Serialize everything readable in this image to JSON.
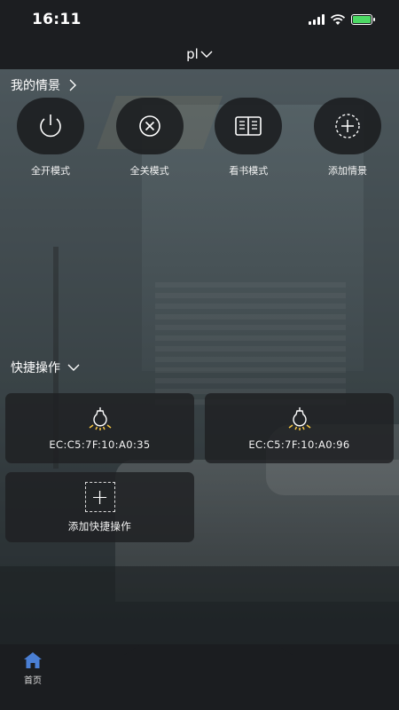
{
  "status": {
    "time": "16:11"
  },
  "header": {
    "home_name": "pl"
  },
  "scenes_section": {
    "title": "我的情景",
    "items": [
      {
        "label": "全开模式",
        "icon": "power-icon"
      },
      {
        "label": "全关模式",
        "icon": "close-circle-icon"
      },
      {
        "label": "看书模式",
        "icon": "book-icon"
      },
      {
        "label": "添加情景",
        "icon": "add-circle-icon"
      }
    ]
  },
  "quick_section": {
    "title": "快捷操作",
    "items": [
      {
        "label": "EC:C5:7F:10:A0:35",
        "icon": "light-bulb-icon"
      },
      {
        "label": "EC:C5:7F:10:A0:96",
        "icon": "light-bulb-icon"
      },
      {
        "label": "添加快捷操作",
        "icon": "add-icon"
      }
    ]
  },
  "bottom_nav": {
    "home_label": "首页"
  },
  "colors": {
    "accent": "#4a7fd4",
    "bulb": "#f5c542",
    "background": "#1c1e21"
  }
}
